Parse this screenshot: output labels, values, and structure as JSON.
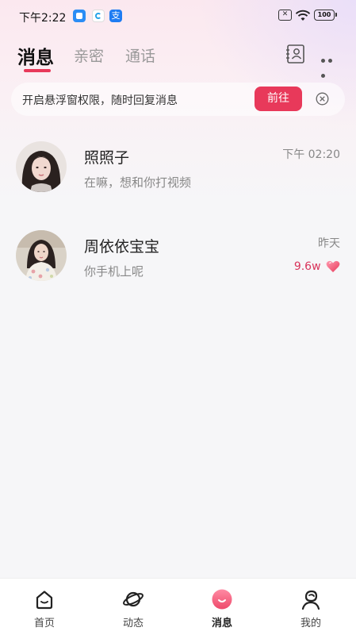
{
  "status_bar": {
    "time": "下午2:22",
    "app3_glyph": "支",
    "sim_glyph": "✕",
    "battery": "100"
  },
  "header": {
    "tabs": [
      {
        "label": "消息",
        "active": true
      },
      {
        "label": "亲密",
        "active": false
      },
      {
        "label": "通话",
        "active": false
      }
    ],
    "icons": [
      "contacts-icon",
      "more-icon"
    ]
  },
  "banner": {
    "text": "开启悬浮窗权限，随时回复消息",
    "button_label": "前往"
  },
  "chats": [
    {
      "name": "照照子",
      "preview": "在嘛，想和你打视频",
      "time": "下午 02:20",
      "intimacy": ""
    },
    {
      "name": "周依依宝宝",
      "preview": "你手机上呢",
      "time": "昨天",
      "intimacy": "9.6w"
    }
  ],
  "bottom_nav": {
    "items": [
      {
        "label": "首页",
        "icon": "home-icon",
        "active": false
      },
      {
        "label": "动态",
        "icon": "planet-icon",
        "active": false
      },
      {
        "label": "消息",
        "icon": "message-icon",
        "active": true
      },
      {
        "label": "我的",
        "icon": "profile-icon",
        "active": false
      }
    ]
  },
  "colors": {
    "accent": "#e8395a",
    "intimacy": "#d9345b"
  }
}
